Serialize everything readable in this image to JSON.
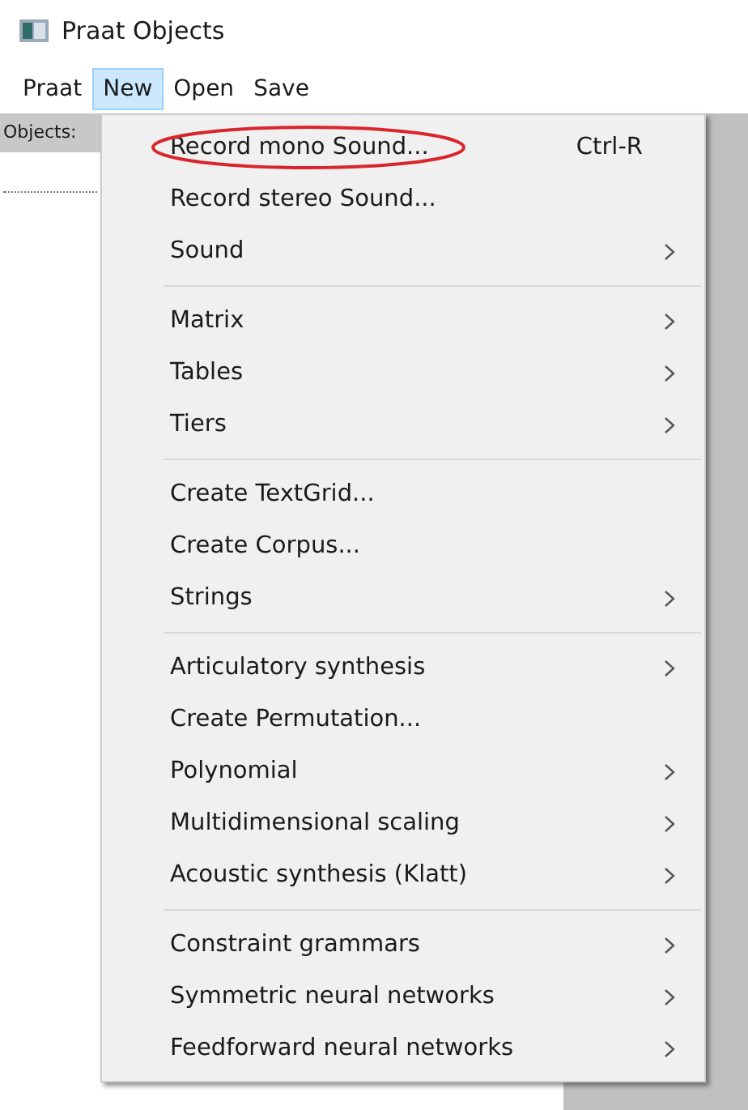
{
  "window": {
    "title": "Praat Objects"
  },
  "menubar": [
    {
      "label": "Praat",
      "selected": false
    },
    {
      "label": "New",
      "selected": true
    },
    {
      "label": "Open",
      "selected": false
    },
    {
      "label": "Save",
      "selected": false
    }
  ],
  "objects_label": "Objects:",
  "menu": {
    "groups": [
      [
        {
          "label": "Record mono Sound...",
          "shortcut": "Ctrl-R",
          "submenu": false,
          "circled": true
        },
        {
          "label": "Record stereo Sound...",
          "submenu": false,
          "circled": false
        },
        {
          "label": "Sound",
          "submenu": true,
          "circled": false
        }
      ],
      [
        {
          "label": "Matrix",
          "submenu": true,
          "circled": false
        },
        {
          "label": "Tables",
          "submenu": true,
          "circled": false
        },
        {
          "label": "Tiers",
          "submenu": true,
          "circled": false
        }
      ],
      [
        {
          "label": "Create TextGrid...",
          "submenu": false,
          "circled": false
        },
        {
          "label": "Create Corpus...",
          "submenu": false,
          "circled": false
        },
        {
          "label": "Strings",
          "submenu": true,
          "circled": false
        }
      ],
      [
        {
          "label": "Articulatory synthesis",
          "submenu": true,
          "circled": false
        },
        {
          "label": "Create Permutation...",
          "submenu": false,
          "circled": false
        },
        {
          "label": "Polynomial",
          "submenu": true,
          "circled": false
        },
        {
          "label": "Multidimensional scaling",
          "submenu": true,
          "circled": false
        },
        {
          "label": "Acoustic synthesis (Klatt)",
          "submenu": true,
          "circled": false
        }
      ],
      [
        {
          "label": "Constraint grammars",
          "submenu": true,
          "circled": false
        },
        {
          "label": "Symmetric neural networks",
          "submenu": true,
          "circled": false
        },
        {
          "label": "Feedforward neural networks",
          "submenu": true,
          "circled": false
        }
      ]
    ]
  }
}
